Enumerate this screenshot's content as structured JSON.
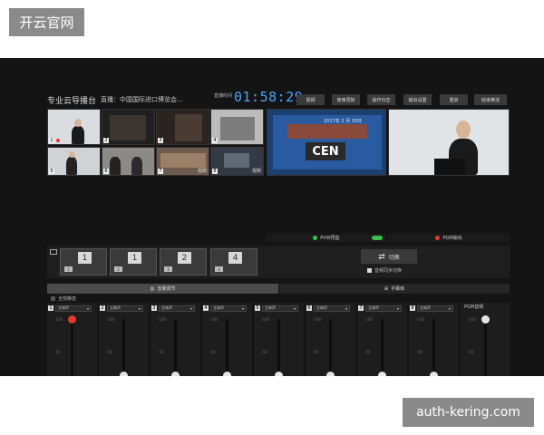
{
  "watermarks": {
    "top": "开云官网",
    "bottom": "auth-kering.com"
  },
  "header": {
    "title": "专业云导播台",
    "live_label": "直播：中国国际进口博览会...",
    "clock_label": "直播时间",
    "clock": "01:58:29",
    "buttons": [
      {
        "label": "视频",
        "style": "blue"
      },
      {
        "label": "使用须知",
        "style": "gray"
      },
      {
        "label": "操作日志",
        "style": "gray"
      },
      {
        "label": "输出设置",
        "style": "gray"
      },
      {
        "label": "重启",
        "style": "gray"
      },
      {
        "label": "结束推流",
        "style": "red"
      }
    ]
  },
  "sources": [
    {
      "num": "1",
      "label": "",
      "live": true
    },
    {
      "num": "2",
      "label": "",
      "live": false
    },
    {
      "num": "3",
      "label": "",
      "live": false
    },
    {
      "num": "4",
      "label": "",
      "live": false
    },
    {
      "num": "5",
      "label": "",
      "live": false
    },
    {
      "num": "6",
      "label": "",
      "live": false
    },
    {
      "num": "7",
      "label": "视频",
      "live": false
    },
    {
      "num": "8",
      "label": "视频",
      "live": false
    }
  ],
  "monitors": {
    "pvw_label": "PVW预监",
    "pgm_label": "PGM输出",
    "pvw_date": "2017年 2 月 20日",
    "pvw_logo": "CEN",
    "pvw_led_color": "#36c34a",
    "pgm_led_color": "#e23b2f"
  },
  "layouts": [
    {
      "num": "1",
      "mini": "1"
    },
    {
      "num": "1",
      "mini": "2"
    },
    {
      "num": "2",
      "mini": "3"
    },
    {
      "num": "4",
      "mini": "4"
    }
  ],
  "switch": {
    "label": "切换",
    "sync_label": "音频同步切换"
  },
  "tabs": [
    {
      "label": "音量调节",
      "active": true
    },
    {
      "label": "字幕库",
      "active": false
    }
  ],
  "mute_all_label": "全部静音",
  "audio": {
    "channels": [
      {
        "idx": "1",
        "mode": "立体声",
        "level": 1.0,
        "red": true
      },
      {
        "idx": "2",
        "mode": "立体声",
        "level": 0.18,
        "red": false
      },
      {
        "idx": "3",
        "mode": "立体声",
        "level": 0.18,
        "red": false
      },
      {
        "idx": "4",
        "mode": "立体声",
        "level": 0.18,
        "red": false
      },
      {
        "idx": "5",
        "mode": "立体声",
        "level": 0.18,
        "red": false
      },
      {
        "idx": "6",
        "mode": "立体声",
        "level": 0.18,
        "red": false
      },
      {
        "idx": "7",
        "mode": "立体声",
        "level": 0.18,
        "red": false
      },
      {
        "idx": "8",
        "mode": "立体声",
        "level": 0.18,
        "red": false
      }
    ],
    "pgm_title": "PGM音频",
    "pgm_level": 1.0,
    "scale": [
      "-100",
      "-50",
      "-5"
    ]
  }
}
